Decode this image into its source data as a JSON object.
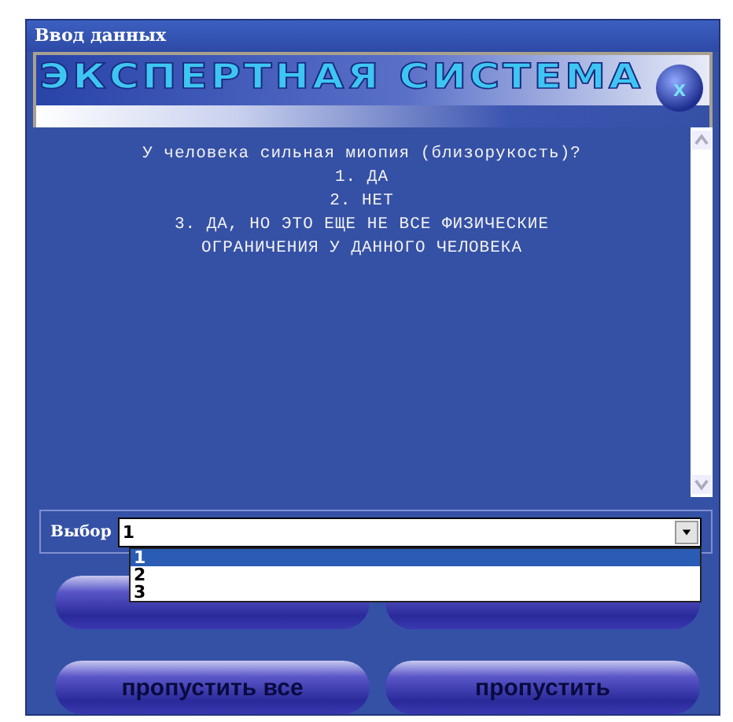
{
  "window": {
    "title": "Ввод данных"
  },
  "banner": {
    "title": "ЭКСПЕРТНАЯ СИСТЕМА",
    "close_label": "x"
  },
  "question": {
    "lines": [
      "У человека сильная миопия (близорукость)?",
      "1. ДА",
      "2. НЕТ",
      "3. ДА, НО ЭТО ЕЩЕ НЕ ВСЕ ФИЗИЧЕСКИЕ",
      "ОГРАНИЧЕНИЯ У ДАННОГО ЧЕЛОВЕКА"
    ]
  },
  "choice": {
    "label": "Выбор",
    "value": "1",
    "expanded": true,
    "options": [
      {
        "label": "1",
        "selected": true
      },
      {
        "label": "2",
        "selected": false
      },
      {
        "label": "3",
        "selected": false
      }
    ]
  },
  "buttons": [
    {
      "kind": "covered"
    },
    {
      "kind": "covered"
    },
    {
      "kind": "labeled",
      "label": "пропустить все"
    },
    {
      "kind": "labeled",
      "label": "пропустить"
    }
  ]
}
